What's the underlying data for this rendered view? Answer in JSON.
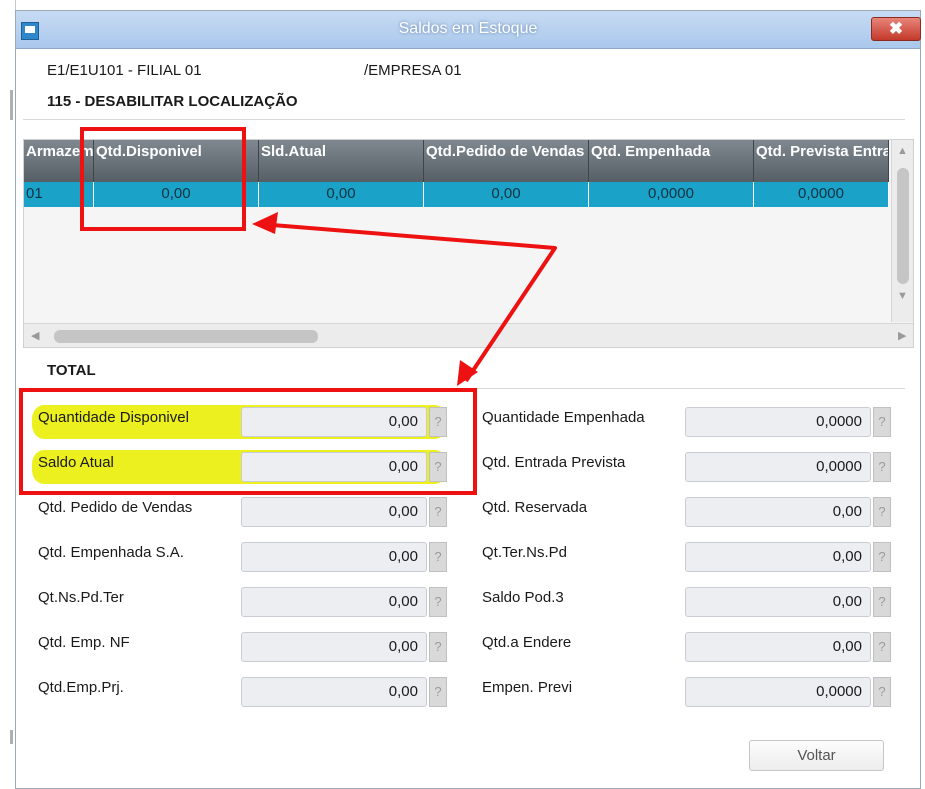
{
  "window": {
    "title": "Saldos em Estoque",
    "close_label": "✖"
  },
  "header": {
    "branch": "E1/E1U101 - FILIAL 01",
    "company": "/EMPRESA 01"
  },
  "section": {
    "name": "115 - DESABILITAR LOCALIZAÇÃO"
  },
  "grid": {
    "columns": [
      "Armazem",
      "Qtd.Disponivel",
      "Sld.Atual",
      "Qtd.Pedido de Vendas",
      "Qtd. Empenhada",
      "Qtd. Prevista Entrada"
    ],
    "rows": [
      [
        "01",
        "0,00",
        "0,00",
        "0,00",
        "0,0000",
        "0,0000"
      ]
    ]
  },
  "total": {
    "title": "TOTAL",
    "left": [
      {
        "label": "Quantidade Disponivel",
        "value": "0,00"
      },
      {
        "label": "Saldo Atual",
        "value": "0,00"
      },
      {
        "label": "Qtd. Pedido de Vendas",
        "value": "0,00"
      },
      {
        "label": "Qtd. Empenhada S.A.",
        "value": "0,00"
      },
      {
        "label": "Qt.Ns.Pd.Ter",
        "value": "0,00"
      },
      {
        "label": "Qtd. Emp. NF",
        "value": "0,00"
      },
      {
        "label": "Qtd.Emp.Prj.",
        "value": "0,00"
      }
    ],
    "right": [
      {
        "label": "Quantidade Empenhada",
        "value": "0,0000"
      },
      {
        "label": "Qtd. Entrada Prevista",
        "value": "0,0000"
      },
      {
        "label": "Qtd. Reservada",
        "value": "0,00"
      },
      {
        "label": "Qt.Ter.Ns.Pd",
        "value": "0,00"
      },
      {
        "label": "Saldo Pod.3",
        "value": "0,00"
      },
      {
        "label": "Qtd.a Endere",
        "value": "0,00"
      },
      {
        "label": "Empen. Previ",
        "value": "0,0000"
      }
    ],
    "help_label": "?"
  },
  "buttons": {
    "back": "Voltar"
  },
  "colors": {
    "annotation": "#ee1111",
    "highlight": "#e9ee00",
    "selected_row": "#1aa2c9",
    "grid_header": "#575f66"
  },
  "icons": {
    "app": "app-window-icon",
    "close": "close-icon",
    "help": "question-icon"
  }
}
